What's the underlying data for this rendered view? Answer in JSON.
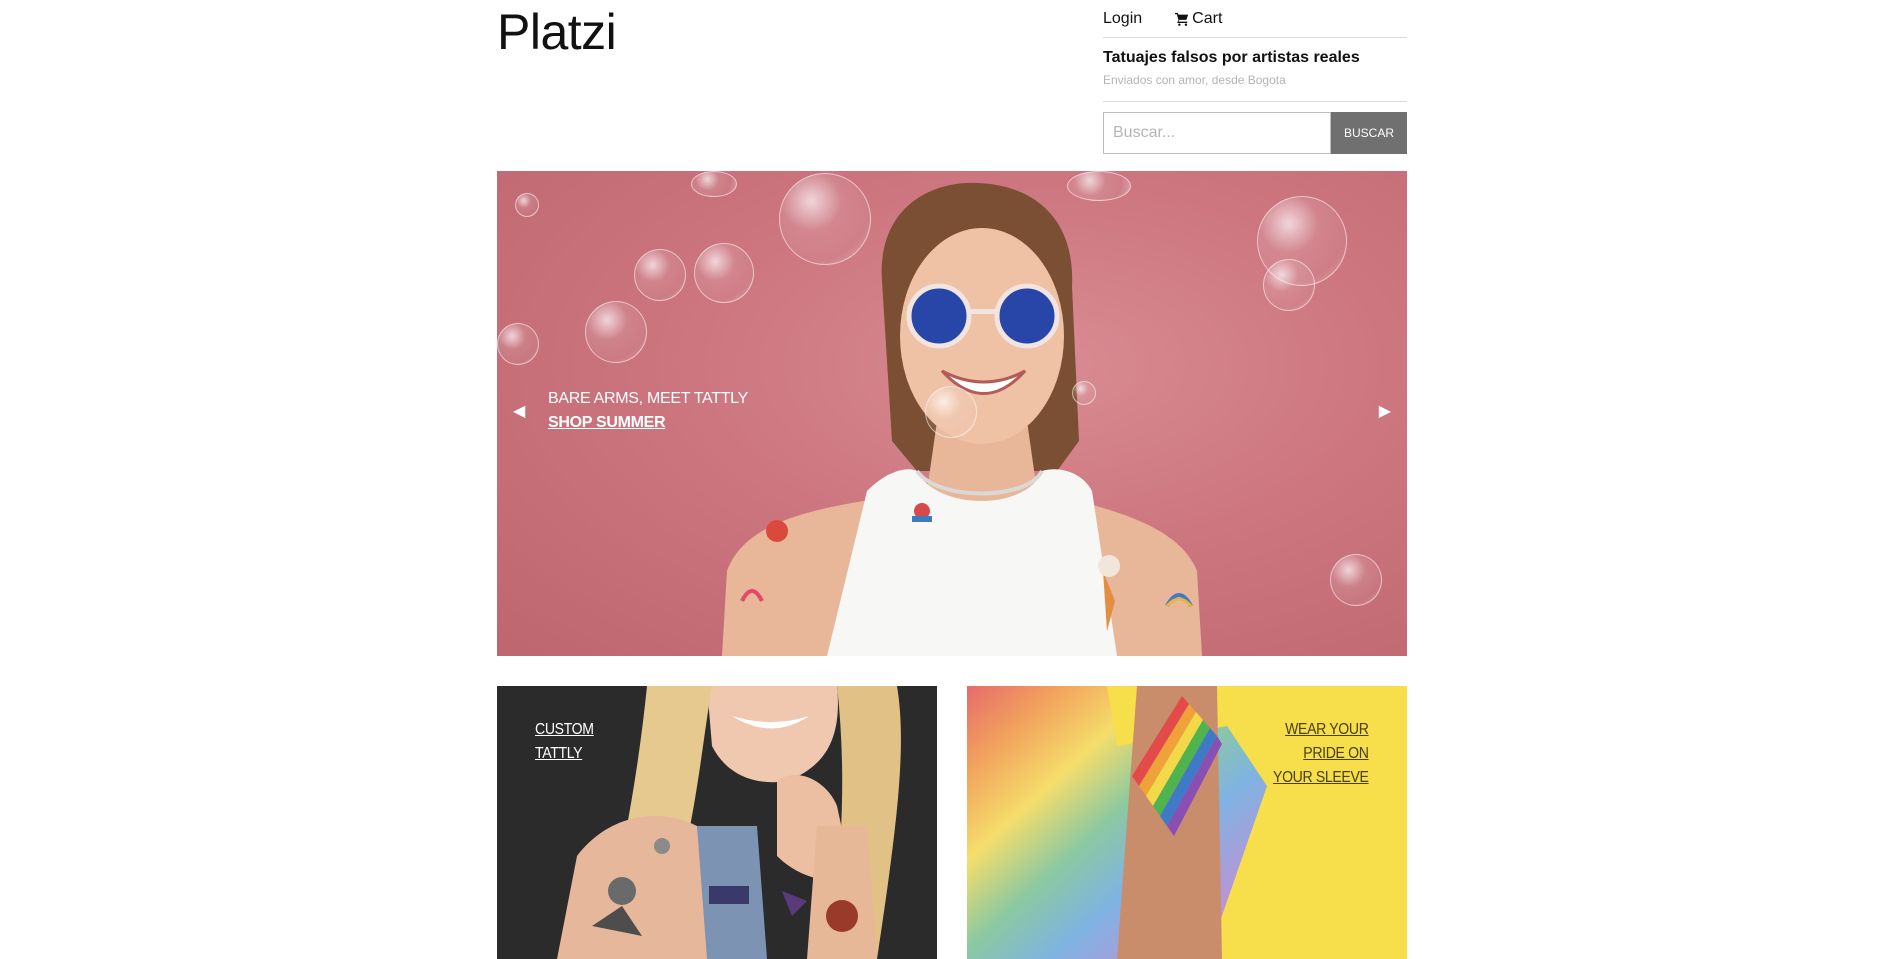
{
  "header": {
    "logo": "Platzi",
    "login_label": "Login",
    "cart_label": "Cart",
    "tagline": "Tatuajes falsos por artistas reales",
    "subtagline": "Enviados con amor, desde Bogota"
  },
  "search": {
    "placeholder": "Buscar...",
    "button_label": "BUSCAR"
  },
  "hero": {
    "line1": "BARE ARMS, MEET TATTLY",
    "cta": "SHOP SUMMER",
    "prev_icon": "triangle-left-icon",
    "next_icon": "triangle-right-icon"
  },
  "tiles": [
    {
      "lines": [
        "CUSTOM",
        "TATTLY"
      ]
    },
    {
      "lines": [
        "WEAR YOUR",
        "PRIDE ON",
        "YOUR SLEEVE"
      ]
    }
  ],
  "colors": {
    "hero_bg": "#cd7680",
    "search_button": "#707070",
    "tile_left_bg": "#2c2c2c",
    "tile_right_bg": "#f6df4a"
  }
}
